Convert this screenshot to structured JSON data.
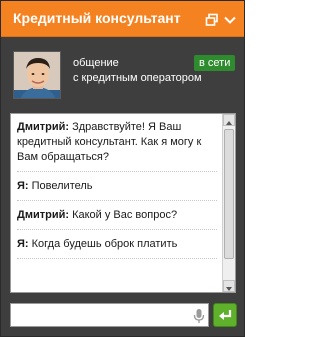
{
  "window": {
    "title": "Кредитный консультант"
  },
  "agent": {
    "name": "общение",
    "role": "с кредитным оператором",
    "status": "в сети"
  },
  "messages": [
    {
      "author": "Дмитрий:",
      "text": " Здравствуйте! Я Ваш кредитный консультант. Как я могу к Вам обращаться?"
    },
    {
      "author": "Я:",
      "text": " Повелитель"
    },
    {
      "author": "Дмитрий:",
      "text": " Какой у Вас вопрос?"
    },
    {
      "author": "Я:",
      "text": " Когда будешь оброк платить"
    }
  ],
  "input": {
    "value": "",
    "placeholder": ""
  },
  "colors": {
    "titlebar": "#f58220",
    "panel": "#3e3e3e",
    "status": "#2e8b2e",
    "send": "#5fb12c"
  },
  "icons": {
    "restore": "restore-window-icon",
    "collapse": "chevron-down-icon",
    "mic": "microphone-icon",
    "send": "enter-arrow-icon"
  }
}
